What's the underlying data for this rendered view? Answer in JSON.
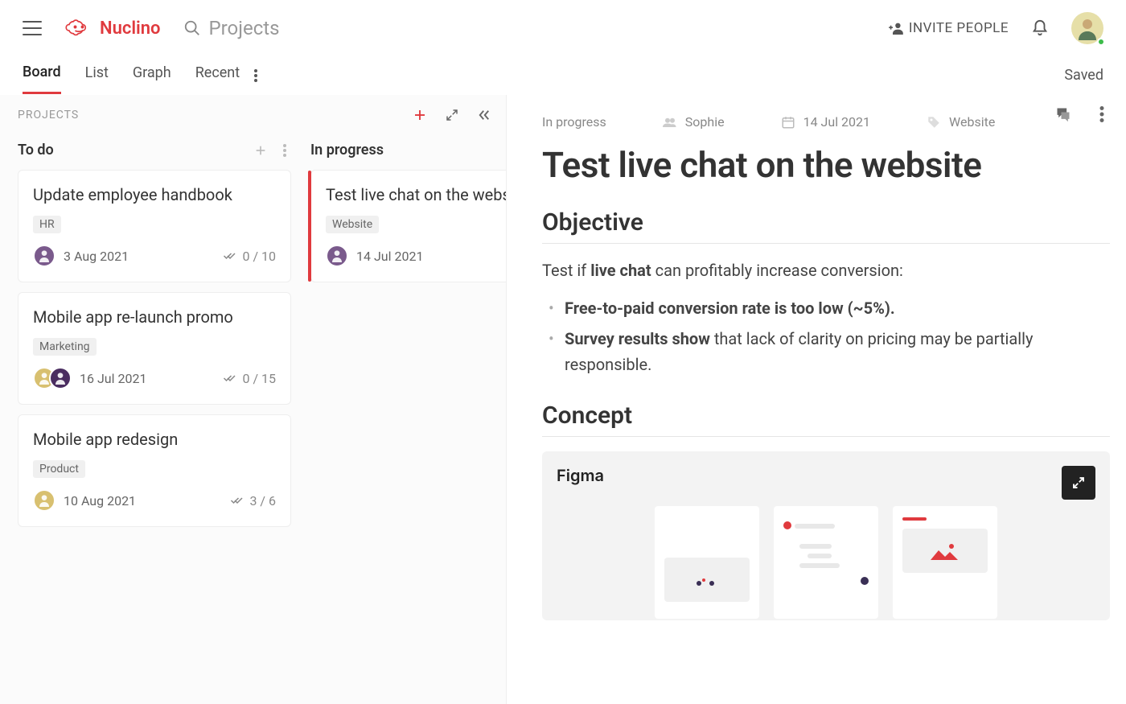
{
  "app": {
    "name": "Nuclino",
    "workspace": "Projects"
  },
  "topbar": {
    "invite_label": "INVITE PEOPLE"
  },
  "tabs": {
    "items": [
      "Board",
      "List",
      "Graph",
      "Recent"
    ],
    "active_index": 0,
    "status": "Saved"
  },
  "board": {
    "title": "PROJECTS",
    "columns": [
      {
        "title": "To do",
        "cards": [
          {
            "title": "Update employee handbook",
            "tag": "HR",
            "date": "3 Aug 2021",
            "count": "0 / 10",
            "avatars": [
              "a1"
            ]
          },
          {
            "title": "Mobile app re-launch promo",
            "tag": "Marketing",
            "date": "16 Jul 2021",
            "count": "0 / 15",
            "avatars": [
              "a2",
              "a3"
            ]
          },
          {
            "title": "Mobile app redesign",
            "tag": "Product",
            "date": "10 Aug 2021",
            "count": "3 / 6",
            "avatars": [
              "a2"
            ]
          }
        ]
      },
      {
        "title": "In progress",
        "cards": [
          {
            "title": "Test live chat on the website",
            "tag": "Website",
            "date": "14 Jul 2021",
            "avatars": [
              "a1"
            ],
            "selected": true
          }
        ]
      }
    ]
  },
  "detail": {
    "meta": {
      "status": "In progress",
      "assignee": "Sophie",
      "date": "14 Jul 2021",
      "tag": "Website"
    },
    "title": "Test live chat on the website",
    "sections": {
      "objective_heading": "Objective",
      "objective_intro_a": "Test if ",
      "objective_intro_b": "live chat",
      "objective_intro_c": " can profitably increase conversion:",
      "bullet1": "Free-to-paid conversion rate is too low (~5%).",
      "bullet2_a": "Survey results show",
      "bullet2_b": " that lack of clarity on pricing may be partially responsible.",
      "concept_heading": "Concept",
      "embed_title": "Figma"
    }
  }
}
